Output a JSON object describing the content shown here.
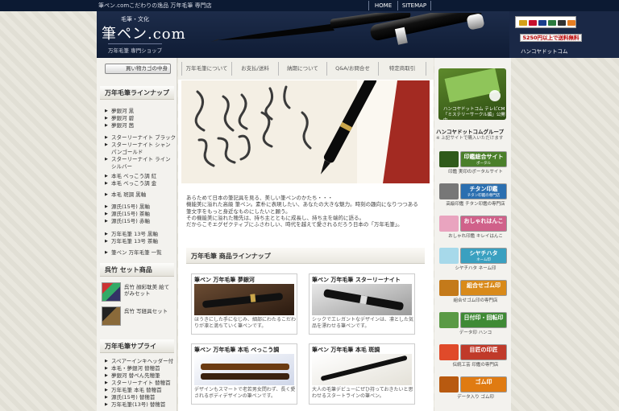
{
  "topbar": {
    "tagline": "筆ペン.comこだわりの逸品 万年毛筆 専門店",
    "nav": [
      "HOME",
      "SITEMAP"
    ]
  },
  "header": {
    "logo_small": "毛筆・文化",
    "logo": "筆ペン.com",
    "logo_sub": "万年毛筆 専門ショップ",
    "shipping": "5250円以上で送料無料",
    "hanko_logo": "ハンコヤドットコム"
  },
  "colors": {
    "navy": "#0c1a33",
    "accent_red": "#b00000",
    "green": "#4d7a22"
  },
  "left": {
    "cart_button": "買い物カゴの中身",
    "lineup_title": "万年毛筆ラインナップ",
    "lineup_groups": [
      [
        "夢銀河 黒",
        "夢銀河 碧",
        "夢銀河 茜"
      ],
      [
        "スターリーナイト ブラック",
        "スターリーナイト シャンパンゴールド",
        "スターリーナイト ラインシルバー"
      ],
      [
        "本毛 べっこう調 紅",
        "本毛 べっこう調 金"
      ],
      [
        "本毛 斑調 黒軸"
      ],
      [
        "源氏(15号) 黒軸",
        "源氏(15号) 茶軸",
        "源氏(15号) 赤軸"
      ],
      [
        "万年毛筆 13号 黒軸",
        "万年毛筆 13号 茶軸"
      ],
      [
        "筆ペン 万年毛筆 一覧"
      ]
    ],
    "set_title": "呉竹 セット商品",
    "sets": [
      "呉竹 顔彩耽美 絵てがみセット",
      "呉竹 写経具セット"
    ],
    "supply_title": "万年毛筆サプライ",
    "supplies": [
      "スペアーインキヘッダー付",
      "本毛・夢銀河 替穂首",
      "夢銀河 替ぺん先穂筆",
      "スターリーナイト 替穂首",
      "万年毛筆 本毛 替穂首",
      "源氏(15号) 替穂首",
      "万年毛筆(13号) 替穂首"
    ]
  },
  "main": {
    "tabs": [
      "万年毛筆について",
      "お支払/送料",
      "納期について",
      "Q&A/お問合せ",
      "特定商取引"
    ],
    "intro": [
      "あらためて日本の筆記具を見る、美しい筆ペンのかたち・・・",
      "機能美に溢れた高級 筆ペン。素朴に表現したい、あなたの大きな魅力。時刻の趣向になりつつある",
      "筆文字をもっと身近なものにしたいと願う。",
      "その機能美に溢れた穂先は、持ち主とともに成長し、持ち主を端的に語る。",
      "だからこそエグゼクティブにふさわしい、時代を越えて愛されるだろう日本の「万年毛筆」。"
    ],
    "lineup_head": "万年毛筆 商品ラインナップ",
    "products": [
      {
        "title": "筆ペン 万年毛筆 夢銀河",
        "desc": "ほうきにした手になじみ、細部にわたるこだわりが凛と満ちていく筆ペンです。"
      },
      {
        "title": "筆ペン 万年毛筆 スターリーナイト",
        "desc": "シックでエレガントなデザインは、凛とした気品を漂わせる筆ペンです。"
      },
      {
        "title": "筆ペン 万年毛筆 本毛 べっこう調",
        "desc": "デザインもスマートで老若男女問わず、長く愛されるボディデザインの筆ペンです。"
      },
      {
        "title": "筆ペン 万年毛筆 本毛 斑調",
        "desc": "大人の毛筆デビューにぜひ持っておきたいと思わせるスタートラインの筆ペン。"
      }
    ]
  },
  "right": {
    "banner_text": [
      "ハンコヤドットコム テレビCM",
      "「ミステリーサークル編」公開中"
    ],
    "group_label": "ハンコヤドットコムグループ",
    "group_sub": "※ 上記サイトで購入いただけます",
    "banners": [
      {
        "title": "印鑑総合サイト",
        "small": "ポータル",
        "caption": "印鑑 実印のポータルサイト",
        "color": "#4a7f2a"
      },
      {
        "title": "チタン印鑑",
        "small": "チタン印鑑の専門店",
        "caption": "高級印鑑 チタン印鑑の専門店",
        "color": "#2b6fb0"
      },
      {
        "title": "おしゃれはんこ",
        "small": "",
        "caption": "おしゃれ印鑑 キレイはんこ",
        "color": "#d0618a"
      },
      {
        "title": "シヤチハタ",
        "small": "ネーム印",
        "caption": "シヤチハタ ネーム印",
        "color": "#3aa0c0"
      },
      {
        "title": "組合せゴム印",
        "small": "",
        "caption": "組合せゴム印の専門店",
        "color": "#d98a1a"
      },
      {
        "title": "日付印・回転印",
        "small": "",
        "caption": "データ印 ハンコ",
        "color": "#3f8a35"
      },
      {
        "title": "目匠の印匠",
        "small": "",
        "caption": "伝統工芸 印鑑の専門店",
        "color": "#c03a2a"
      },
      {
        "title": "ゴム印",
        "small": "",
        "caption": "データ入り ゴム印",
        "color": "#e07b12"
      }
    ]
  }
}
